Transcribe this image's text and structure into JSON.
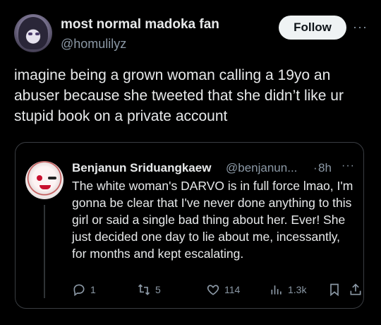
{
  "post": {
    "author_name": "most normal madoka fan",
    "author_handle": "@homulilyz",
    "follow_label": "Follow",
    "more_label": "···",
    "text": "imagine being a grown woman calling a 19yo an abuser because she tweeted that she didn’t like ur stupid book on a private account"
  },
  "quote": {
    "author_name": "Benjanun Sriduangkaew",
    "author_handle": "@benjanun...",
    "dot": "·",
    "time": "8h",
    "more_label": "···",
    "text": "The white woman's DARVO is in full force lmao, I'm gonna be clear that I've never done anything to this girl or said a single bad thing about her. Ever! She just decided one day to lie about me, incessantly, for months and kept escalating.",
    "actions": {
      "replies": "1",
      "reposts": "5",
      "likes": "114",
      "views": "1.3k"
    }
  },
  "icons": {
    "reply": "reply-icon",
    "repost": "repost-icon",
    "like": "like-icon",
    "views": "views-icon",
    "bookmark": "bookmark-icon",
    "share": "share-icon"
  }
}
